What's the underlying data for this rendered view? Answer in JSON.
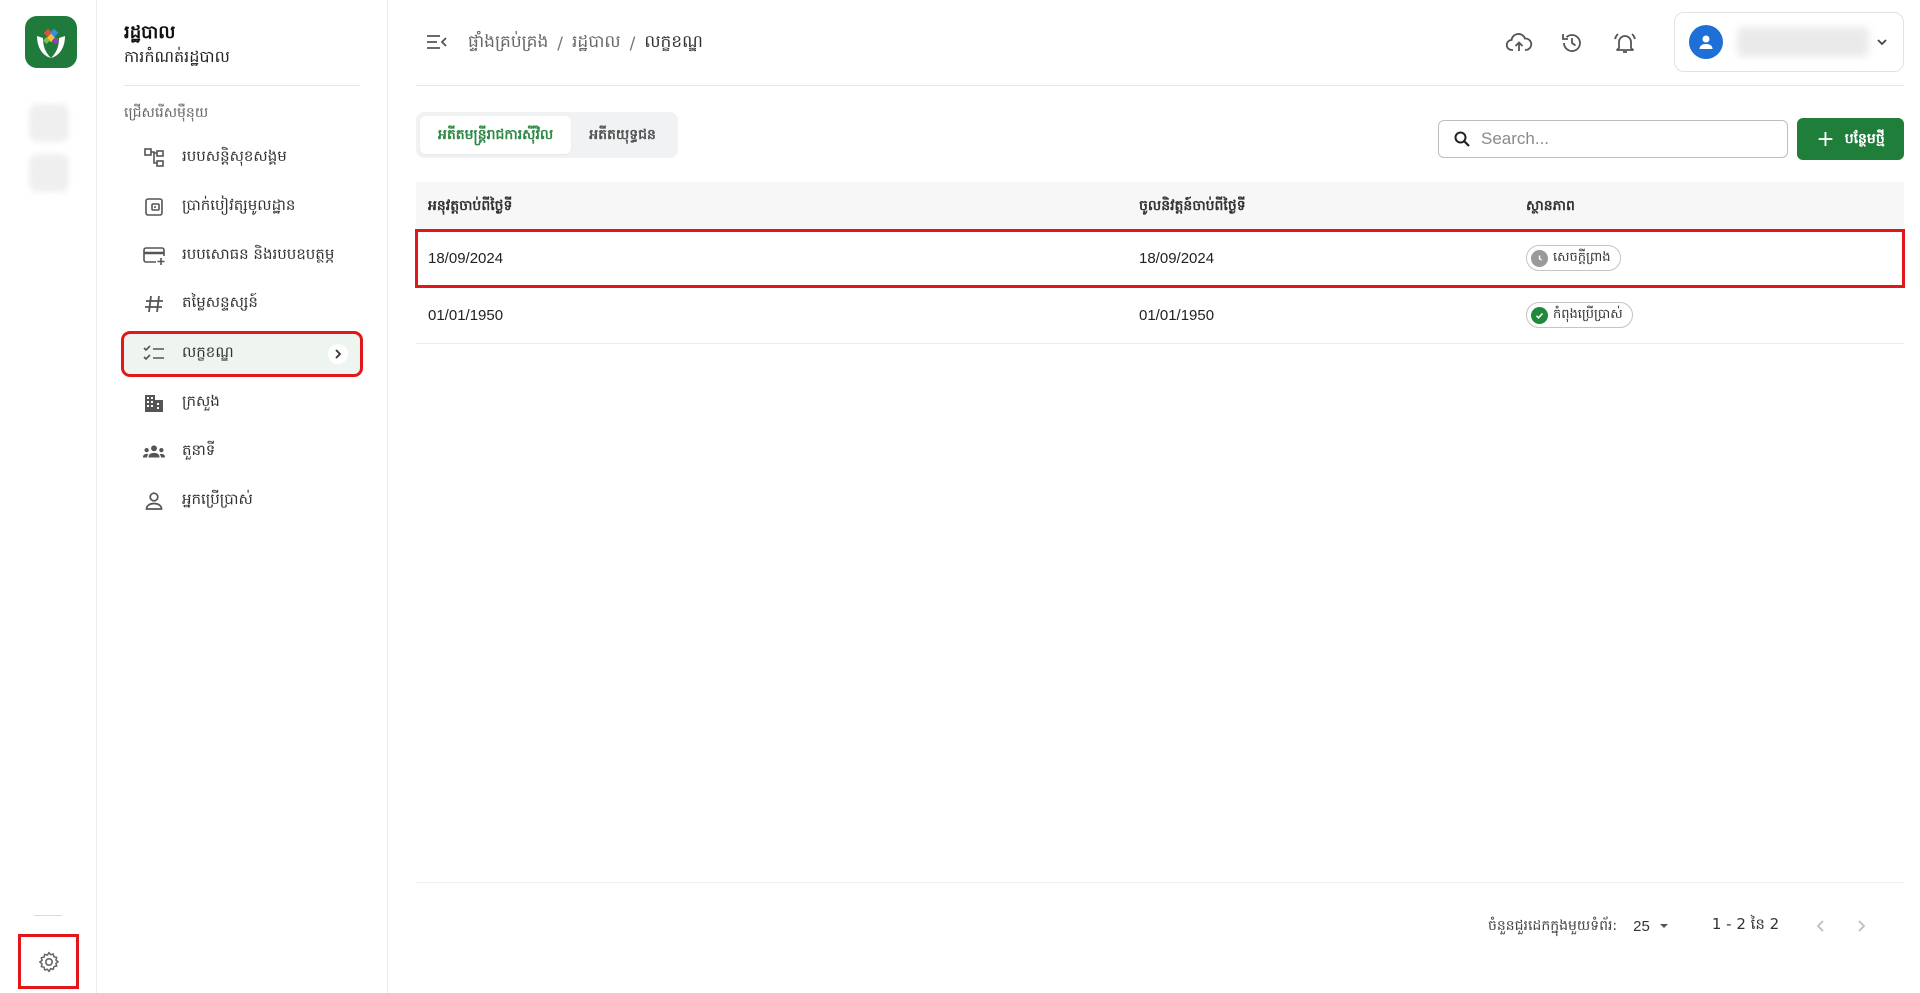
{
  "colors": {
    "primary": "#1e7e3a",
    "highlight": "#e3161b",
    "avatar": "#1e6fd6"
  },
  "sidebar": {
    "title": "រដ្ឋបាល",
    "subtitle": "ការកំណត់រដ្ឋបាល",
    "section_label": "ជ្រើសរើសម៉ឺនុយ",
    "items": [
      {
        "label": "របបសន្តិសុខសង្គម",
        "icon": "hierarchy-icon"
      },
      {
        "label": "ប្រាក់បៀវត្សមូលដ្ឋាន",
        "icon": "wallet-icon"
      },
      {
        "label": "របបសោធន និងរបបឧបត្ថម្ភ",
        "icon": "card-add-icon"
      },
      {
        "label": "តម្លៃសន្ទស្សន៍",
        "icon": "hash-icon"
      },
      {
        "label": "លក្ខខណ្ឌ",
        "icon": "checklist-icon",
        "active": true
      },
      {
        "label": "ក្រសួង",
        "icon": "building-icon"
      },
      {
        "label": "តួនាទី",
        "icon": "group-icon"
      },
      {
        "label": "អ្នកប្រើប្រាស់",
        "icon": "person-icon"
      }
    ]
  },
  "breadcrumb": {
    "items": [
      "ផ្ទាំងគ្រប់គ្រង",
      "រដ្ឋបាល",
      "លក្ខខណ្ឌ"
    ],
    "separator": "/"
  },
  "tabs": [
    {
      "label": "អតីតមន្ត្រីរាជការស៊ីវិល",
      "active": true
    },
    {
      "label": "អតីតយុទ្ធជន",
      "active": false
    }
  ],
  "search": {
    "placeholder": "Search..."
  },
  "add_button": {
    "label": "បន្ថែមថ្មី"
  },
  "table": {
    "columns": [
      "អនុវត្តចាប់ពីថ្ងៃទី",
      "ចូលនិវត្តន៍ចាប់ពីថ្ងៃទី",
      "ស្ថានភាព"
    ],
    "rows": [
      {
        "apply_from": "18/09/2024",
        "retire_from": "18/09/2024",
        "status": "សេចក្តីព្រាង",
        "status_type": "draft",
        "selected": true
      },
      {
        "apply_from": "01/01/1950",
        "retire_from": "01/01/1950",
        "status": "កំពុងប្រើប្រាស់",
        "status_type": "active",
        "selected": false
      }
    ]
  },
  "pagination": {
    "rows_per_page_label": "ចំនួនជួរដេកក្នុងមួយទំព័រ:",
    "rows_per_page": "25",
    "range": "1 - 2 នៃ 2"
  }
}
